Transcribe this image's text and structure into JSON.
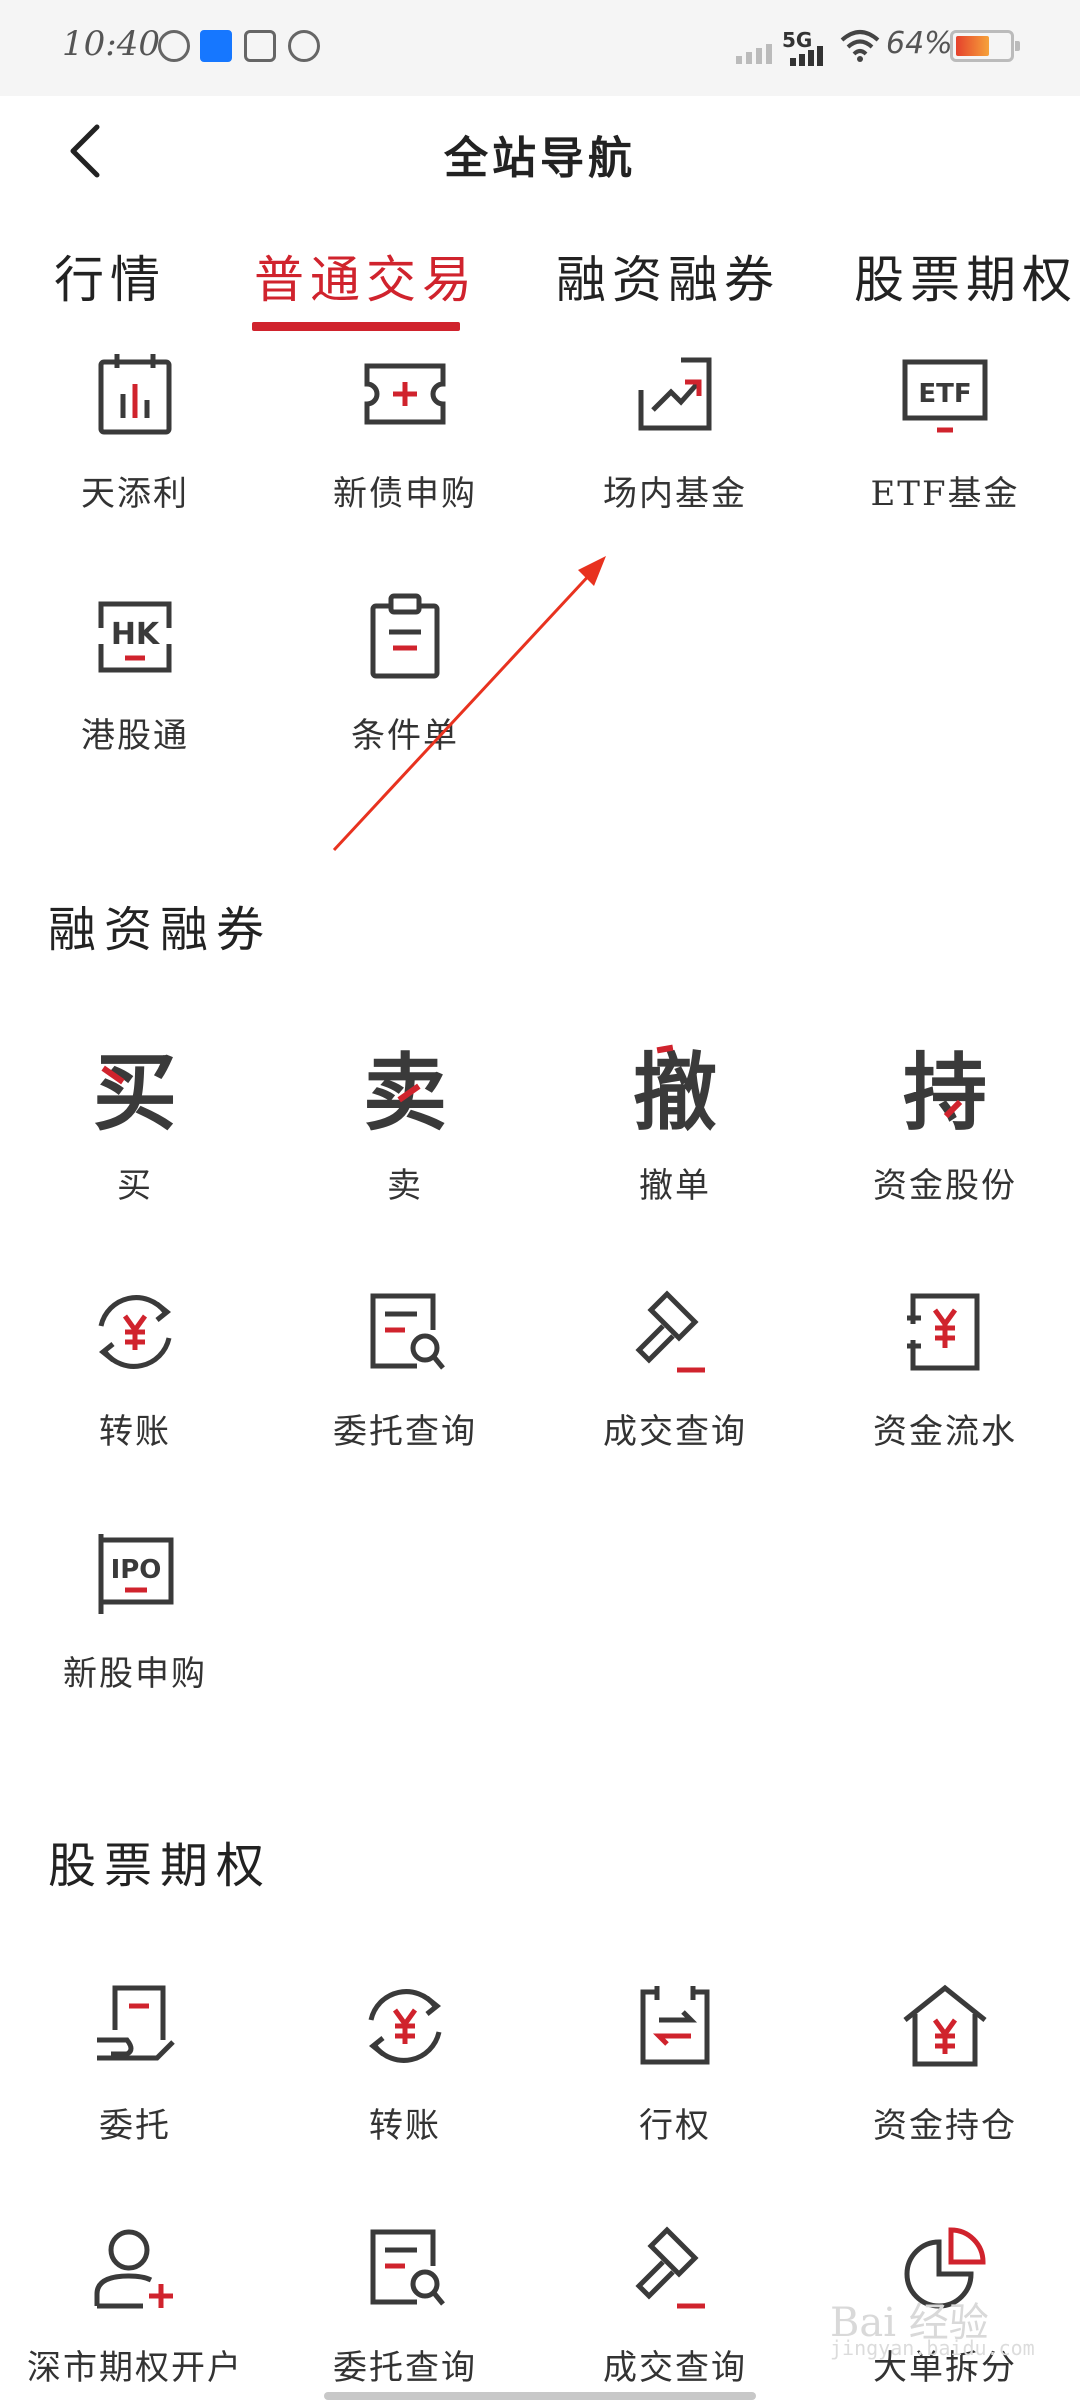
{
  "status_bar": {
    "time": "10:40",
    "network": "5G",
    "battery": "64%",
    "battery_level": 0.64,
    "icons": [
      "k-icon",
      "alipay-icon",
      "play-icon",
      "leaf-icon",
      "signal-icon",
      "wifi-icon",
      "battery-icon"
    ]
  },
  "header": {
    "title": "全站导航",
    "back_icon": "chevron-left-icon"
  },
  "tabs": [
    {
      "label": "行情"
    },
    {
      "label": "普通交易",
      "active": true
    },
    {
      "label": "融资融券"
    },
    {
      "label": "股票期权"
    }
  ],
  "normal_trade": {
    "items": [
      {
        "label": "天添利",
        "icon": "calendar-chart-icon"
      },
      {
        "label": "新债申购",
        "icon": "ticket-plus-icon"
      },
      {
        "label": "场内基金",
        "icon": "trend-up-icon"
      },
      {
        "label": "ETF基金",
        "icon": "etf-icon"
      },
      {
        "label": "港股通",
        "icon": "hk-icon"
      },
      {
        "label": "条件单",
        "icon": "clipboard-icon"
      }
    ]
  },
  "margin_trade": {
    "title": "融资融券",
    "items": [
      {
        "label": "买",
        "icon": "buy-glyph-icon",
        "glyph": "买"
      },
      {
        "label": "卖",
        "icon": "sell-glyph-icon",
        "glyph": "卖"
      },
      {
        "label": "撤单",
        "icon": "cancel-glyph-icon",
        "glyph": "撤"
      },
      {
        "label": "资金股份",
        "icon": "hold-glyph-icon",
        "glyph": "持"
      },
      {
        "label": "转账",
        "icon": "yen-transfer-icon"
      },
      {
        "label": "委托查询",
        "icon": "doc-search-icon"
      },
      {
        "label": "成交查询",
        "icon": "gavel-icon"
      },
      {
        "label": "资金流水",
        "icon": "yen-ledger-icon"
      },
      {
        "label": "新股申购",
        "icon": "ipo-icon"
      }
    ]
  },
  "stock_options": {
    "title": "股票期权",
    "items": [
      {
        "label": "委托",
        "icon": "hand-doc-icon"
      },
      {
        "label": "转账",
        "icon": "yen-transfer-icon"
      },
      {
        "label": "行权",
        "icon": "exchange-doc-icon"
      },
      {
        "label": "资金持仓",
        "icon": "yen-house-icon"
      },
      {
        "label": "深市期权开户",
        "icon": "user-add-icon"
      },
      {
        "label": "委托查询",
        "icon": "doc-search-icon"
      },
      {
        "label": "成交查询",
        "icon": "gavel-icon"
      },
      {
        "label": "大单拆分",
        "icon": "pie-icon"
      }
    ]
  },
  "colors": {
    "accent": "#d0232d",
    "icon_stroke": "#3a3a3a",
    "text": "#333333"
  },
  "watermark": {
    "text": "Bai 经验",
    "sub": "jingyan.baidu.com"
  }
}
